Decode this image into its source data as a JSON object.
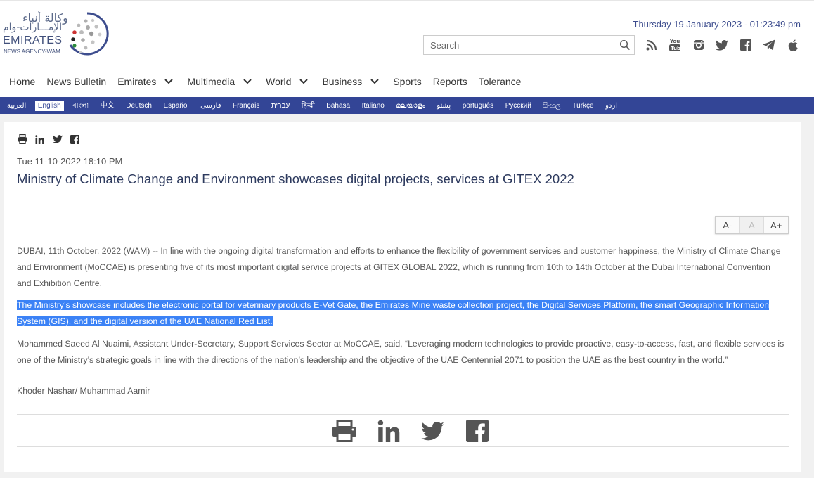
{
  "brand": {
    "arabic_line1": "وكالة أنباء",
    "arabic_line2": "الإمـــارات-وام",
    "name": "EMIRATES",
    "subtitle": "NEWS AGENCY-WAM"
  },
  "header": {
    "datetime": "Thursday 19 January 2023 - 01:23:49 pm",
    "search_placeholder": "Search",
    "socials": [
      "rss-icon",
      "youtube-icon",
      "instagram-icon",
      "twitter-icon",
      "facebook-icon",
      "telegram-icon",
      "apple-icon"
    ]
  },
  "nav": {
    "items": [
      {
        "label": "Home",
        "dropdown": false
      },
      {
        "label": "News Bulletin",
        "dropdown": false
      },
      {
        "label": "Emirates",
        "dropdown": true
      },
      {
        "label": "Multimedia",
        "dropdown": true
      },
      {
        "label": "World",
        "dropdown": true
      },
      {
        "label": "Business",
        "dropdown": true
      },
      {
        "label": "Sports",
        "dropdown": false
      },
      {
        "label": "Reports",
        "dropdown": false
      },
      {
        "label": "Tolerance",
        "dropdown": false
      }
    ]
  },
  "languages": {
    "active": "English",
    "items": [
      "العربية",
      "English",
      "বাংলা",
      "中文",
      "Deutsch",
      "Español",
      "فارسی",
      "Français",
      "עברית",
      "हिन्दी",
      "Bahasa",
      "Italiano",
      "മലയാളം",
      "پښتو",
      "português",
      "Русский",
      "සිංහල",
      "Türkçe",
      "اردو"
    ]
  },
  "article": {
    "date": "Tue 11-10-2022 18:10 PM",
    "title": "Ministry of Climate Change and Environment showcases digital projects, services at GITEX 2022",
    "font_controls": {
      "decrease": "A-",
      "reset": "A",
      "increase": "A+"
    },
    "paragraphs": [
      "DUBAI, 11th October, 2022 (WAM) -- In line with the ongoing digital transformation and efforts to enhance the flexibility of government services and customer happiness, the Ministry of Climate Change and Environment (MoCCAE) is presenting five of its most important digital service projects at GITEX GLOBAL 2022, which is running from 10th to 14th October at the Dubai International Convention and Exhibition Centre.",
      "The Ministry’s showcase includes the electronic portal for veterinary products E-Vet Gate, the Emirates Mine waste collection project, the Digital Services Platform, the smart Geographic Information System (GIS), and the digital version of the UAE National Red List.",
      "Mohammed Saeed Al Nuaimi, Assistant Under-Secretary, Support Services Sector at MoCCAE, said, “Leveraging modern technologies to provide proactive, easy-to-access, fast, and flexible services is one of the Ministry’s strategic goals in line with the directions of the nation’s leadership and the objective of the UAE Centennial 2071 to position the UAE as the best country in the world.”"
    ],
    "author": "Khoder Nashar/ Muhammad Aamir"
  },
  "colors": {
    "brand_blue": "#334596",
    "title": "#2d3a5e",
    "selection": "#3b82f6"
  }
}
